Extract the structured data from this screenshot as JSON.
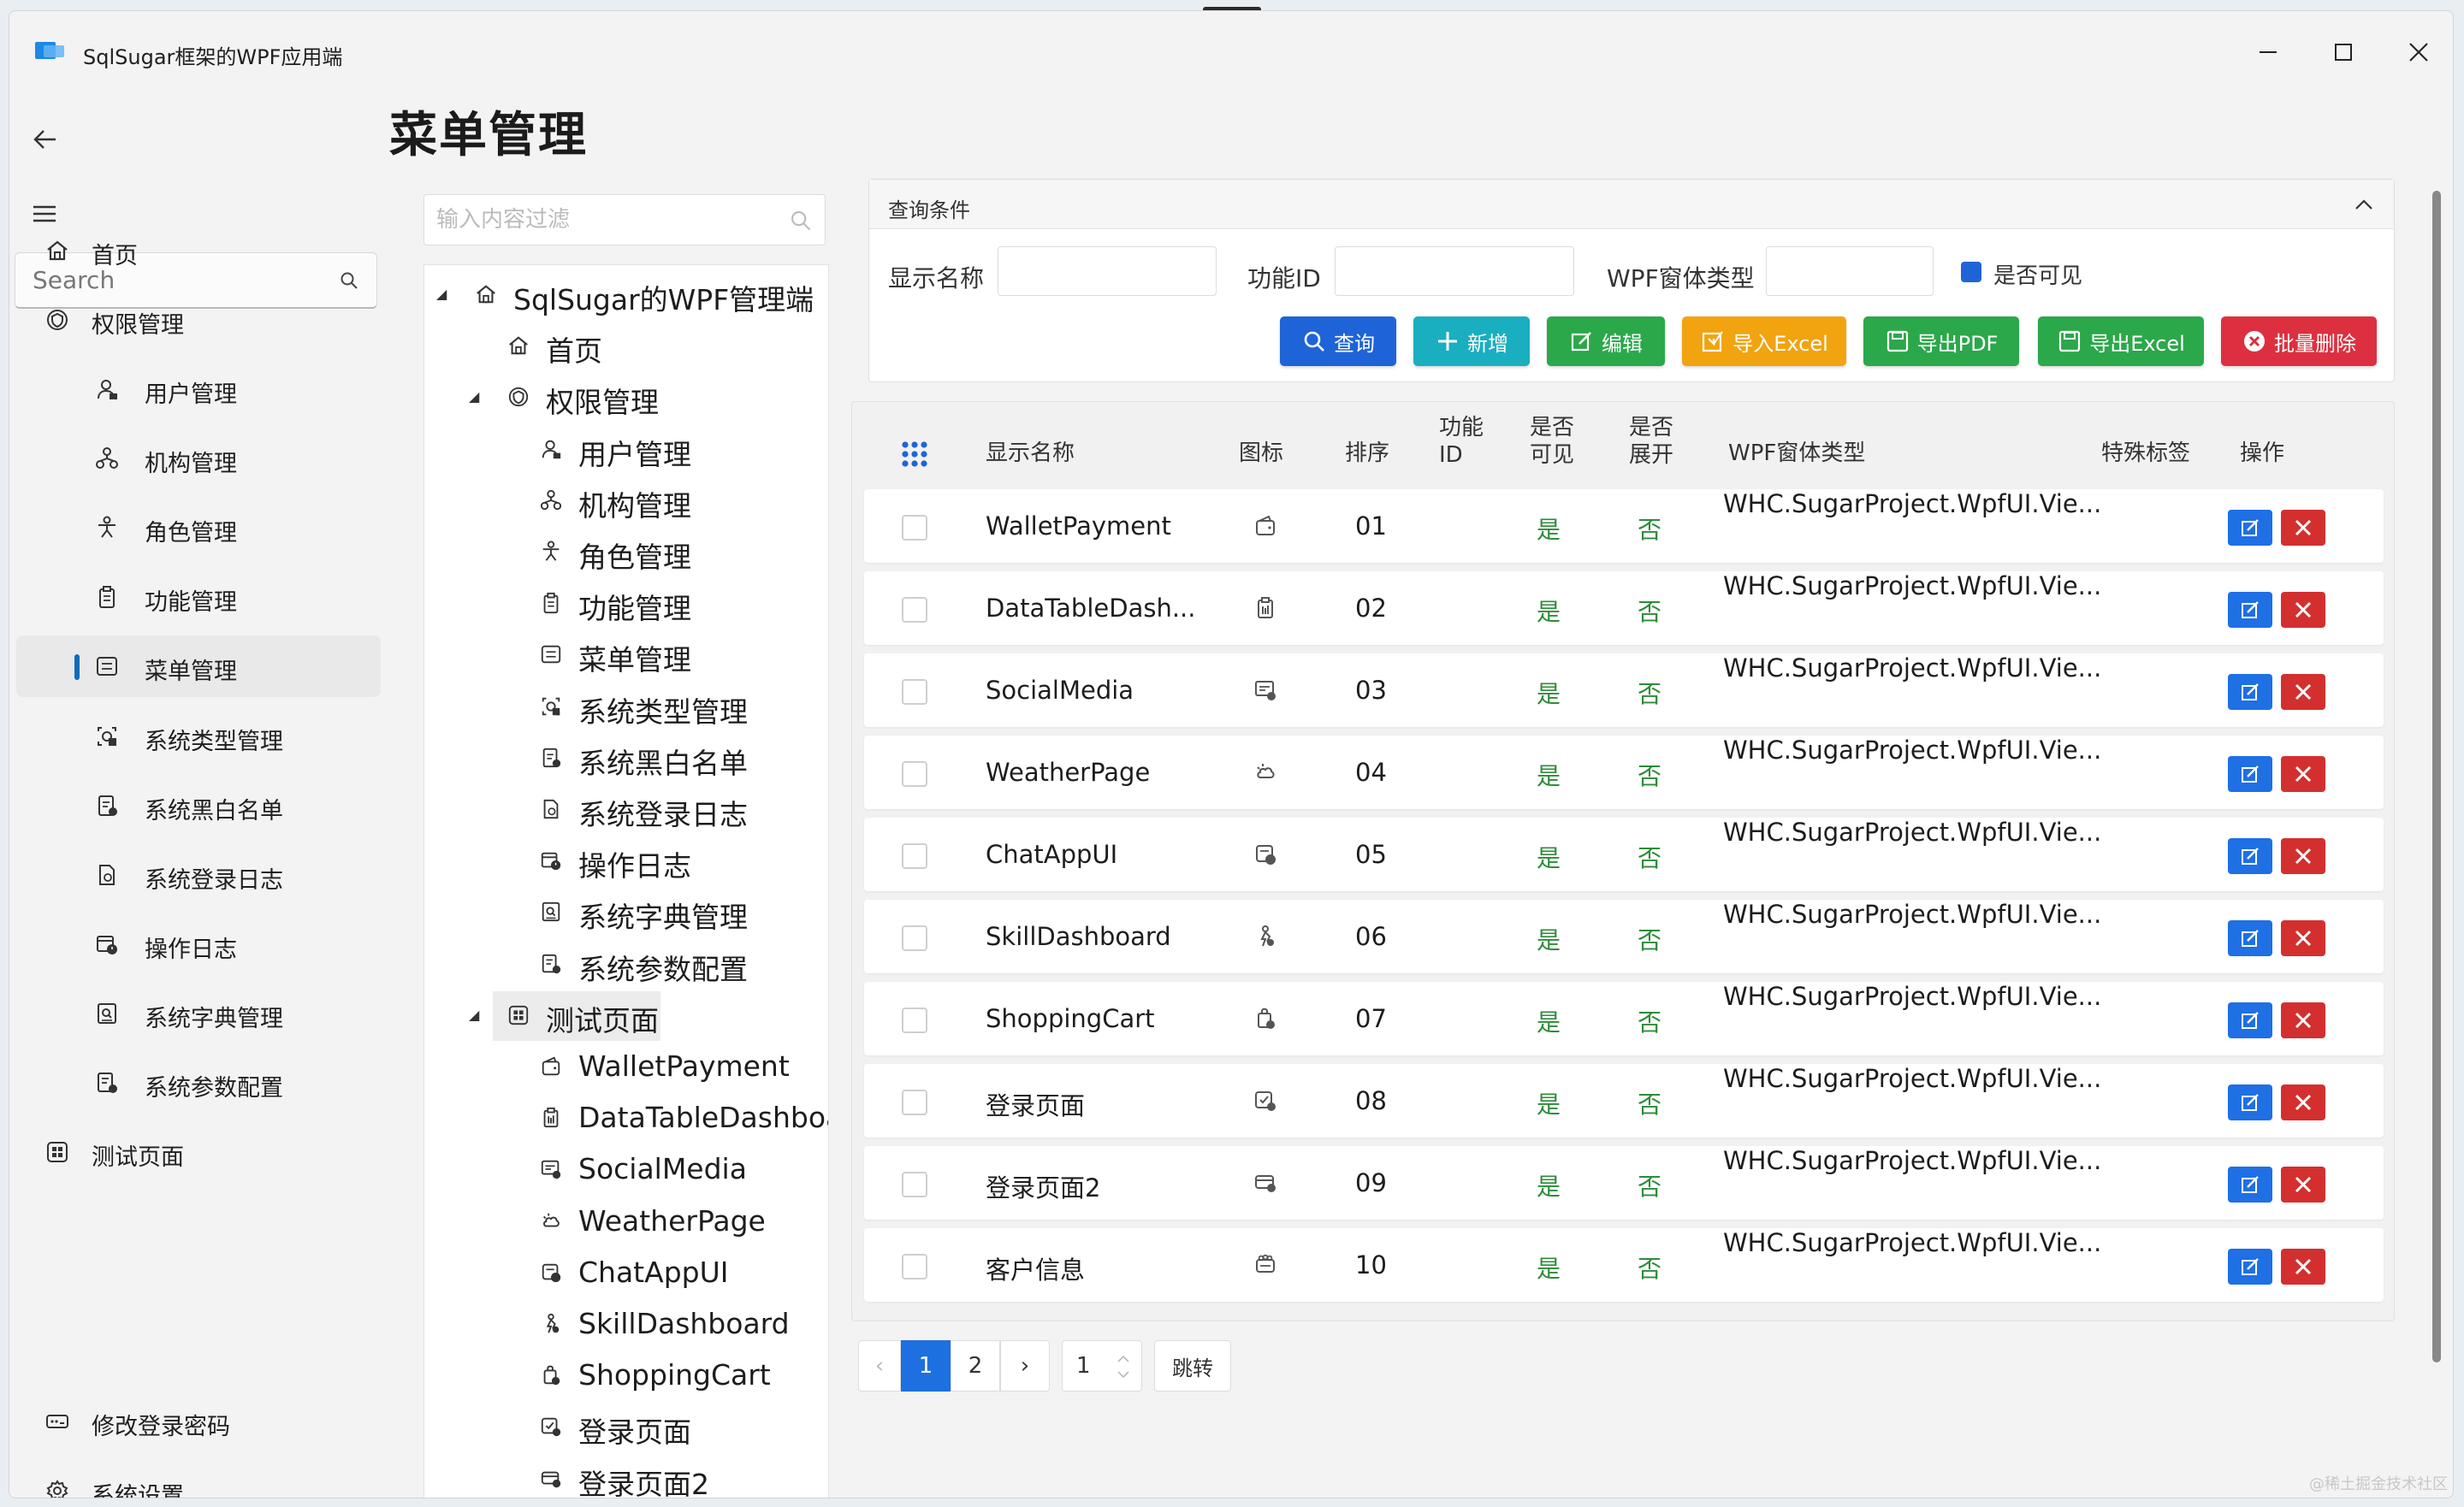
{
  "window": {
    "title": "SqlSugar框架的WPF应用端",
    "minimize_icon": "minimize-icon",
    "maximize_icon": "maximize-icon",
    "close_icon": "close-icon"
  },
  "nav": {
    "search_placeholder": "Search",
    "items": [
      {
        "label": "首页",
        "icon": "home-icon"
      },
      {
        "label": "权限管理",
        "icon": "shield-icon"
      },
      {
        "label": "用户管理",
        "icon": "user-icon"
      },
      {
        "label": "机构管理",
        "icon": "org-icon"
      },
      {
        "label": "角色管理",
        "icon": "role-icon"
      },
      {
        "label": "功能管理",
        "icon": "clipboard-icon"
      },
      {
        "label": "菜单管理",
        "icon": "menu-icon",
        "active": true
      },
      {
        "label": "系统类型管理",
        "icon": "type-icon"
      },
      {
        "label": "系统黑白名单",
        "icon": "list-icon"
      },
      {
        "label": "系统登录日志",
        "icon": "log-icon"
      },
      {
        "label": "操作日志",
        "icon": "calendar-clock-icon"
      },
      {
        "label": "系统字典管理",
        "icon": "dictionary-icon"
      },
      {
        "label": "系统参数配置",
        "icon": "config-icon"
      },
      {
        "label": "测试页面",
        "icon": "grid-icon"
      },
      {
        "label": "修改登录密码",
        "icon": "password-icon"
      },
      {
        "label": "系统设置",
        "icon": "gear-icon"
      }
    ]
  },
  "page": {
    "title": "菜单管理",
    "tree_filter_placeholder": "输入内容过滤"
  },
  "tree": [
    {
      "label": "SqlSugar的WPF管理端",
      "toggle": "◢"
    },
    {
      "label": "首页"
    },
    {
      "label": "权限管理",
      "toggle": "◢"
    },
    {
      "label": "用户管理"
    },
    {
      "label": "机构管理"
    },
    {
      "label": "角色管理"
    },
    {
      "label": "功能管理"
    },
    {
      "label": "菜单管理"
    },
    {
      "label": "系统类型管理"
    },
    {
      "label": "系统黑白名单"
    },
    {
      "label": "系统登录日志"
    },
    {
      "label": "操作日志"
    },
    {
      "label": "系统字典管理"
    },
    {
      "label": "系统参数配置"
    },
    {
      "label": "测试页面",
      "toggle": "◢",
      "selected": true
    },
    {
      "label": "WalletPayment"
    },
    {
      "label": "DataTableDashboa"
    },
    {
      "label": "SocialMedia"
    },
    {
      "label": "WeatherPage"
    },
    {
      "label": "ChatAppUI"
    },
    {
      "label": "SkillDashboard"
    },
    {
      "label": "ShoppingCart"
    },
    {
      "label": "登录页面"
    },
    {
      "label": "登录页面2"
    }
  ],
  "query": {
    "header": "查询条件",
    "display_name_label": "显示名称",
    "function_id_label": "功能ID",
    "wpf_type_label": "WPF窗体类型",
    "visible_label": "是否可见",
    "buttons": {
      "search": "查询",
      "add": "新增",
      "edit": "编辑",
      "import_excel": "导入Excel",
      "export_pdf": "导出PDF",
      "export_excel": "导出Excel",
      "batch_delete": "批量删除"
    }
  },
  "grid": {
    "headers": {
      "name": "显示名称",
      "icon": "图标",
      "order": "排序",
      "function_id_1": "功能",
      "function_id_2": "ID",
      "visible_1": "是否",
      "visible_2": "可见",
      "expand_1": "是否",
      "expand_2": "展开",
      "wpf_type": "WPF窗体类型",
      "special_tag": "特殊标签",
      "action": "操作"
    },
    "rows": [
      {
        "name": "WalletPayment",
        "icon": "wallet-icon",
        "order": "01",
        "visible": "是",
        "expand": "否",
        "type": "WHC.SugarProject.WpfUI.Vie..."
      },
      {
        "name": "DataTableDash...",
        "icon": "table-icon",
        "order": "02",
        "visible": "是",
        "expand": "否",
        "type": "WHC.SugarProject.WpfUI.Vie..."
      },
      {
        "name": "SocialMedia",
        "icon": "social-icon",
        "order": "03",
        "visible": "是",
        "expand": "否",
        "type": "WHC.SugarProject.WpfUI.Vie..."
      },
      {
        "name": "WeatherPage",
        "icon": "weather-icon",
        "order": "04",
        "visible": "是",
        "expand": "否",
        "type": "WHC.SugarProject.WpfUI.Vie..."
      },
      {
        "name": "ChatAppUI",
        "icon": "chat-icon",
        "order": "05",
        "visible": "是",
        "expand": "否",
        "type": "WHC.SugarProject.WpfUI.Vie..."
      },
      {
        "name": "SkillDashboard",
        "icon": "skill-icon",
        "order": "06",
        "visible": "是",
        "expand": "否",
        "type": "WHC.SugarProject.WpfUI.Vie..."
      },
      {
        "name": "ShoppingCart",
        "icon": "cart-icon",
        "order": "07",
        "visible": "是",
        "expand": "否",
        "type": "WHC.SugarProject.WpfUI.Vie..."
      },
      {
        "name": "登录页面",
        "icon": "login-icon",
        "order": "08",
        "visible": "是",
        "expand": "否",
        "type": "WHC.SugarProject.WpfUI.Vie..."
      },
      {
        "name": "登录页面2",
        "icon": "login2-icon",
        "order": "09",
        "visible": "是",
        "expand": "否",
        "type": "WHC.SugarProject.WpfUI.Vie..."
      },
      {
        "name": "客户信息",
        "icon": "customer-icon",
        "order": "10",
        "visible": "是",
        "expand": "否",
        "type": "WHC.SugarProject.WpfUI.Vie..."
      }
    ]
  },
  "pager": {
    "prev": "‹",
    "pages": [
      "1",
      "2"
    ],
    "next": "›",
    "jump_value": "1",
    "jump_label": "跳转"
  },
  "watermark": "@稀土掘金技术社区",
  "colors": {
    "primary": "#1e64d8",
    "info": "#17a2b8",
    "success": "#28a745",
    "warning": "#f0a500",
    "danger": "#dc3545",
    "yes_no_text": "#2e8b3a"
  }
}
